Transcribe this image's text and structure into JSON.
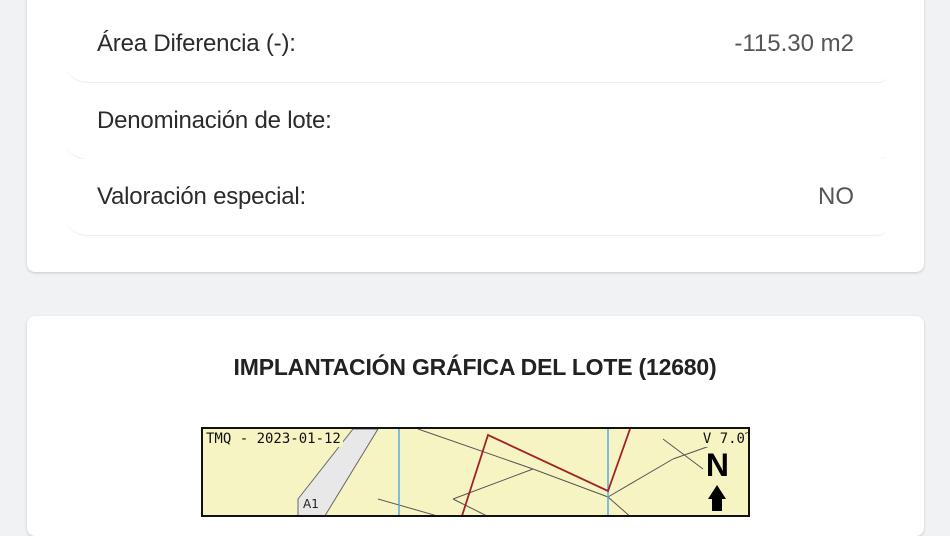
{
  "details": {
    "rows": [
      {
        "label": "Área Diferencia (-):",
        "value": "-115.30 m2"
      },
      {
        "label": "Denominación de lote:",
        "value": ""
      },
      {
        "label": "Valoración especial:",
        "value": "NO"
      }
    ]
  },
  "graphic_section": {
    "title": "IMPLANTACIÓN GRÁFICA DEL LOTE (12680)",
    "map": {
      "date_stamp": "TMQ - 2023-01-12",
      "version": "V 7.0",
      "north_label": "N",
      "lot_label": "A1",
      "background_color": "#f7f4c4",
      "lot_outline_color": "#a0222a",
      "grid_line_color": "#5aa8e0"
    }
  }
}
